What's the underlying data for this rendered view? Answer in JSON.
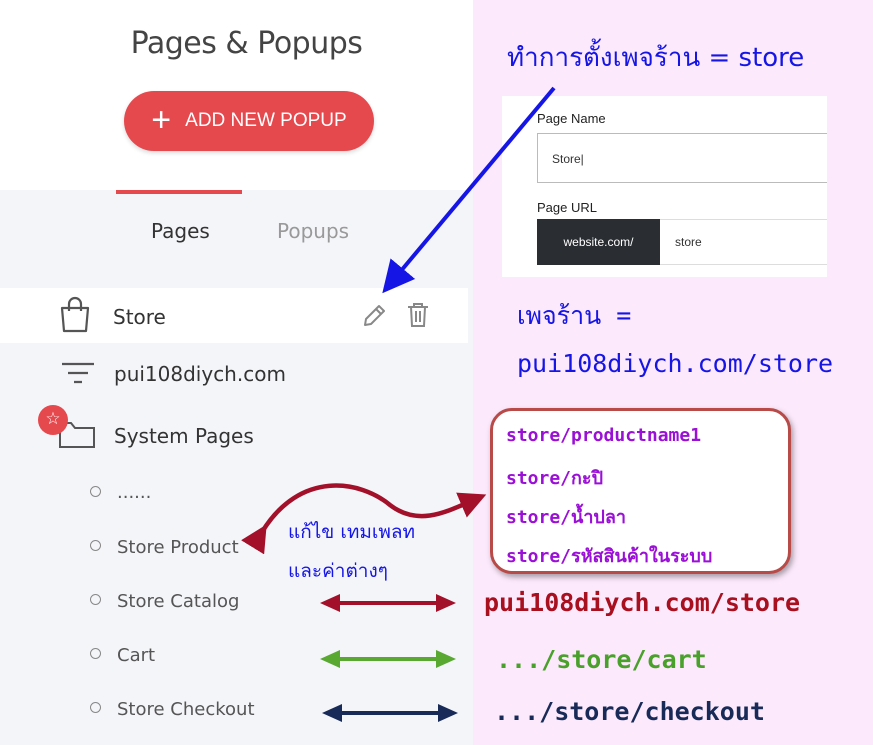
{
  "sidebar": {
    "title": "Pages & Popups",
    "add_button_label": "ADD NEW POPUP",
    "tabs": [
      {
        "label": "Pages",
        "active": true
      },
      {
        "label": "Popups",
        "active": false
      }
    ],
    "items": [
      {
        "label": "Store",
        "icon": "shopping-bag-icon",
        "selected": true
      },
      {
        "label": "pui108diych.com",
        "icon": "filter-lines-icon"
      },
      {
        "label": "System Pages",
        "icon": "folder-icon",
        "badge_icon": "star-icon"
      }
    ],
    "system_pages": [
      "......",
      "Store Product",
      "Store Catalog",
      "Cart",
      "Store Checkout"
    ]
  },
  "page_settings": {
    "heading": "ทำการตั้งเพจร้าน = store",
    "page_name_label": "Page Name",
    "page_name_value": "Store|",
    "page_url_label": "Page URL",
    "url_prefix": "website.com/",
    "url_value": "store"
  },
  "annotations": {
    "shop_page_line1": "เพจร้าน =",
    "shop_page_line2": "pui108diych.com/store",
    "product_urls": [
      "store/productname1",
      "store/กะปิ",
      "store/น้ำปลา",
      "store/รหัสสินค้าในระบบ"
    ],
    "edit_note_line1": "แก้ไข เทมเพลท",
    "edit_note_line2": "และค่าต่างๆ",
    "catalog_url": "pui108diych.com/store",
    "cart_url": ".../store/cart",
    "checkout_url": ".../store/checkout"
  },
  "colors": {
    "accent_red": "#e5484d",
    "annotation_blue": "#1515e6",
    "purple": "#9b10d6",
    "dark_red": "#a80f1f",
    "green": "#49a02a",
    "navy": "#182a57",
    "right_bg": "#fce9fb"
  }
}
